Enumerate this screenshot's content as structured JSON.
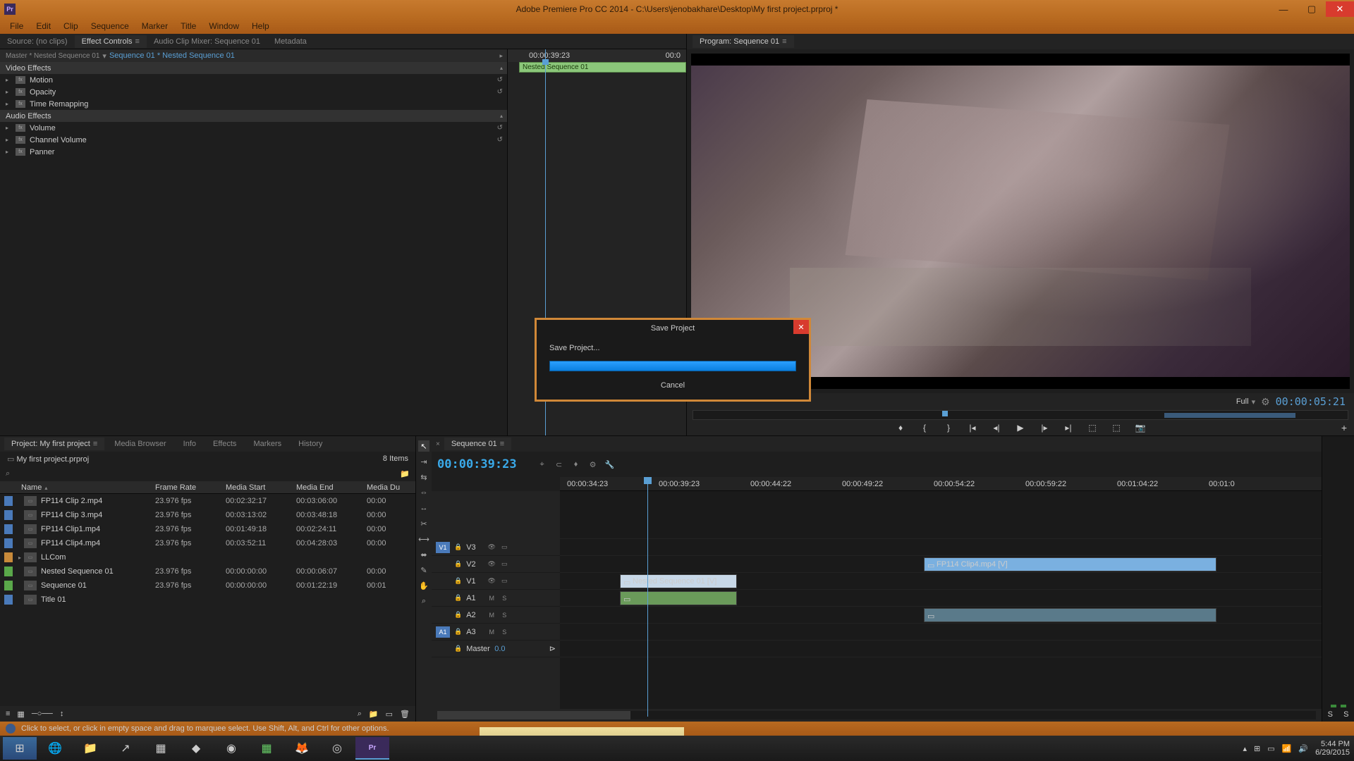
{
  "titlebar": {
    "app_badge": "Pr",
    "title": "Adobe Premiere Pro CC 2014 - C:\\Users\\jenobakhare\\Desktop\\My first project.prproj *"
  },
  "menubar": [
    "File",
    "Edit",
    "Clip",
    "Sequence",
    "Marker",
    "Title",
    "Window",
    "Help"
  ],
  "source_tabs": {
    "source": "Source: (no clips)",
    "effect_controls": "Effect Controls",
    "audio_mixer": "Audio Clip Mixer: Sequence 01",
    "metadata": "Metadata"
  },
  "ec": {
    "breadcrumb_master": "Master * Nested Sequence 01",
    "breadcrumb_seq": "Sequence 01 * Nested Sequence 01",
    "time1": "00:00:39:23",
    "time2": "00:0",
    "clip_label": "Nested Sequence 01",
    "video_header": "Video Effects",
    "motion": "Motion",
    "opacity": "Opacity",
    "time_remap": "Time Remapping",
    "audio_header": "Audio Effects",
    "volume": "Volume",
    "channel_vol": "Channel Volume",
    "panner": "Panner",
    "timecode": "00:00:39:23"
  },
  "program": {
    "tab": "Program: Sequence 01",
    "resolution": "Full",
    "timecode": "00:00:05:21"
  },
  "dialog": {
    "title": "Save Project",
    "message": "Save Project...",
    "cancel": "Cancel"
  },
  "project": {
    "tab_project": "Project: My first project",
    "tab_media": "Media Browser",
    "tab_info": "Info",
    "tab_effects": "Effects",
    "tab_markers": "Markers",
    "tab_history": "History",
    "file": "My first project.prproj",
    "item_count": "8 Items",
    "cols": {
      "name": "Name",
      "fr": "Frame Rate",
      "ms": "Media Start",
      "me": "Media End",
      "md": "Media Du"
    },
    "rows": [
      {
        "badge": "blue",
        "name": "FP114 Clip 2.mp4",
        "fr": "23.976 fps",
        "ms": "00:02:32:17",
        "me": "00:03:06:00",
        "md": "00:00"
      },
      {
        "badge": "blue",
        "name": "FP114 Clip 3.mp4",
        "fr": "23.976 fps",
        "ms": "00:03:13:02",
        "me": "00:03:48:18",
        "md": "00:00"
      },
      {
        "badge": "blue",
        "name": "FP114 Clip1.mp4",
        "fr": "23.976 fps",
        "ms": "00:01:49:18",
        "me": "00:02:24:11",
        "md": "00:00"
      },
      {
        "badge": "blue",
        "name": "FP114 Clip4.mp4",
        "fr": "23.976 fps",
        "ms": "00:03:52:11",
        "me": "00:04:28:03",
        "md": "00:00"
      },
      {
        "badge": "orange",
        "name": "LLCom",
        "fr": "",
        "ms": "",
        "me": "",
        "md": ""
      },
      {
        "badge": "green",
        "name": "Nested Sequence 01",
        "fr": "23.976 fps",
        "ms": "00:00:00:00",
        "me": "00:00:06:07",
        "md": "00:00"
      },
      {
        "badge": "green",
        "name": "Sequence 01",
        "fr": "23.976 fps",
        "ms": "00:00:00:00",
        "me": "00:01:22:19",
        "md": "00:01"
      },
      {
        "badge": "blue",
        "name": "Title 01",
        "fr": "",
        "ms": "",
        "me": "",
        "md": ""
      }
    ]
  },
  "timeline": {
    "tab": "Sequence 01",
    "timecode": "00:00:39:23",
    "ruler": [
      "00:00:34:23",
      "00:00:39:23",
      "00:00:44:22",
      "00:00:49:22",
      "00:00:54:22",
      "00:00:59:22",
      "00:01:04:22",
      "00:01:0"
    ],
    "tracks": {
      "v3": "V3",
      "v2": "V2",
      "v1": "V1",
      "a1": "A1",
      "a2": "A2",
      "a3": "A3",
      "master": "Master",
      "master_val": "0.0"
    },
    "clips": {
      "nested_v": "Nested Sequence 01 [V]",
      "clip4": "FP114 Clip4.mp4 [V]"
    },
    "meter_label": "S"
  },
  "statusbar": {
    "text": "Click to select, or click in empty space and drag to marquee select. Use Shift, Alt, and Ctrl for other options."
  },
  "taskbar": {
    "time": "5:44 PM",
    "date": "6/29/2015"
  }
}
